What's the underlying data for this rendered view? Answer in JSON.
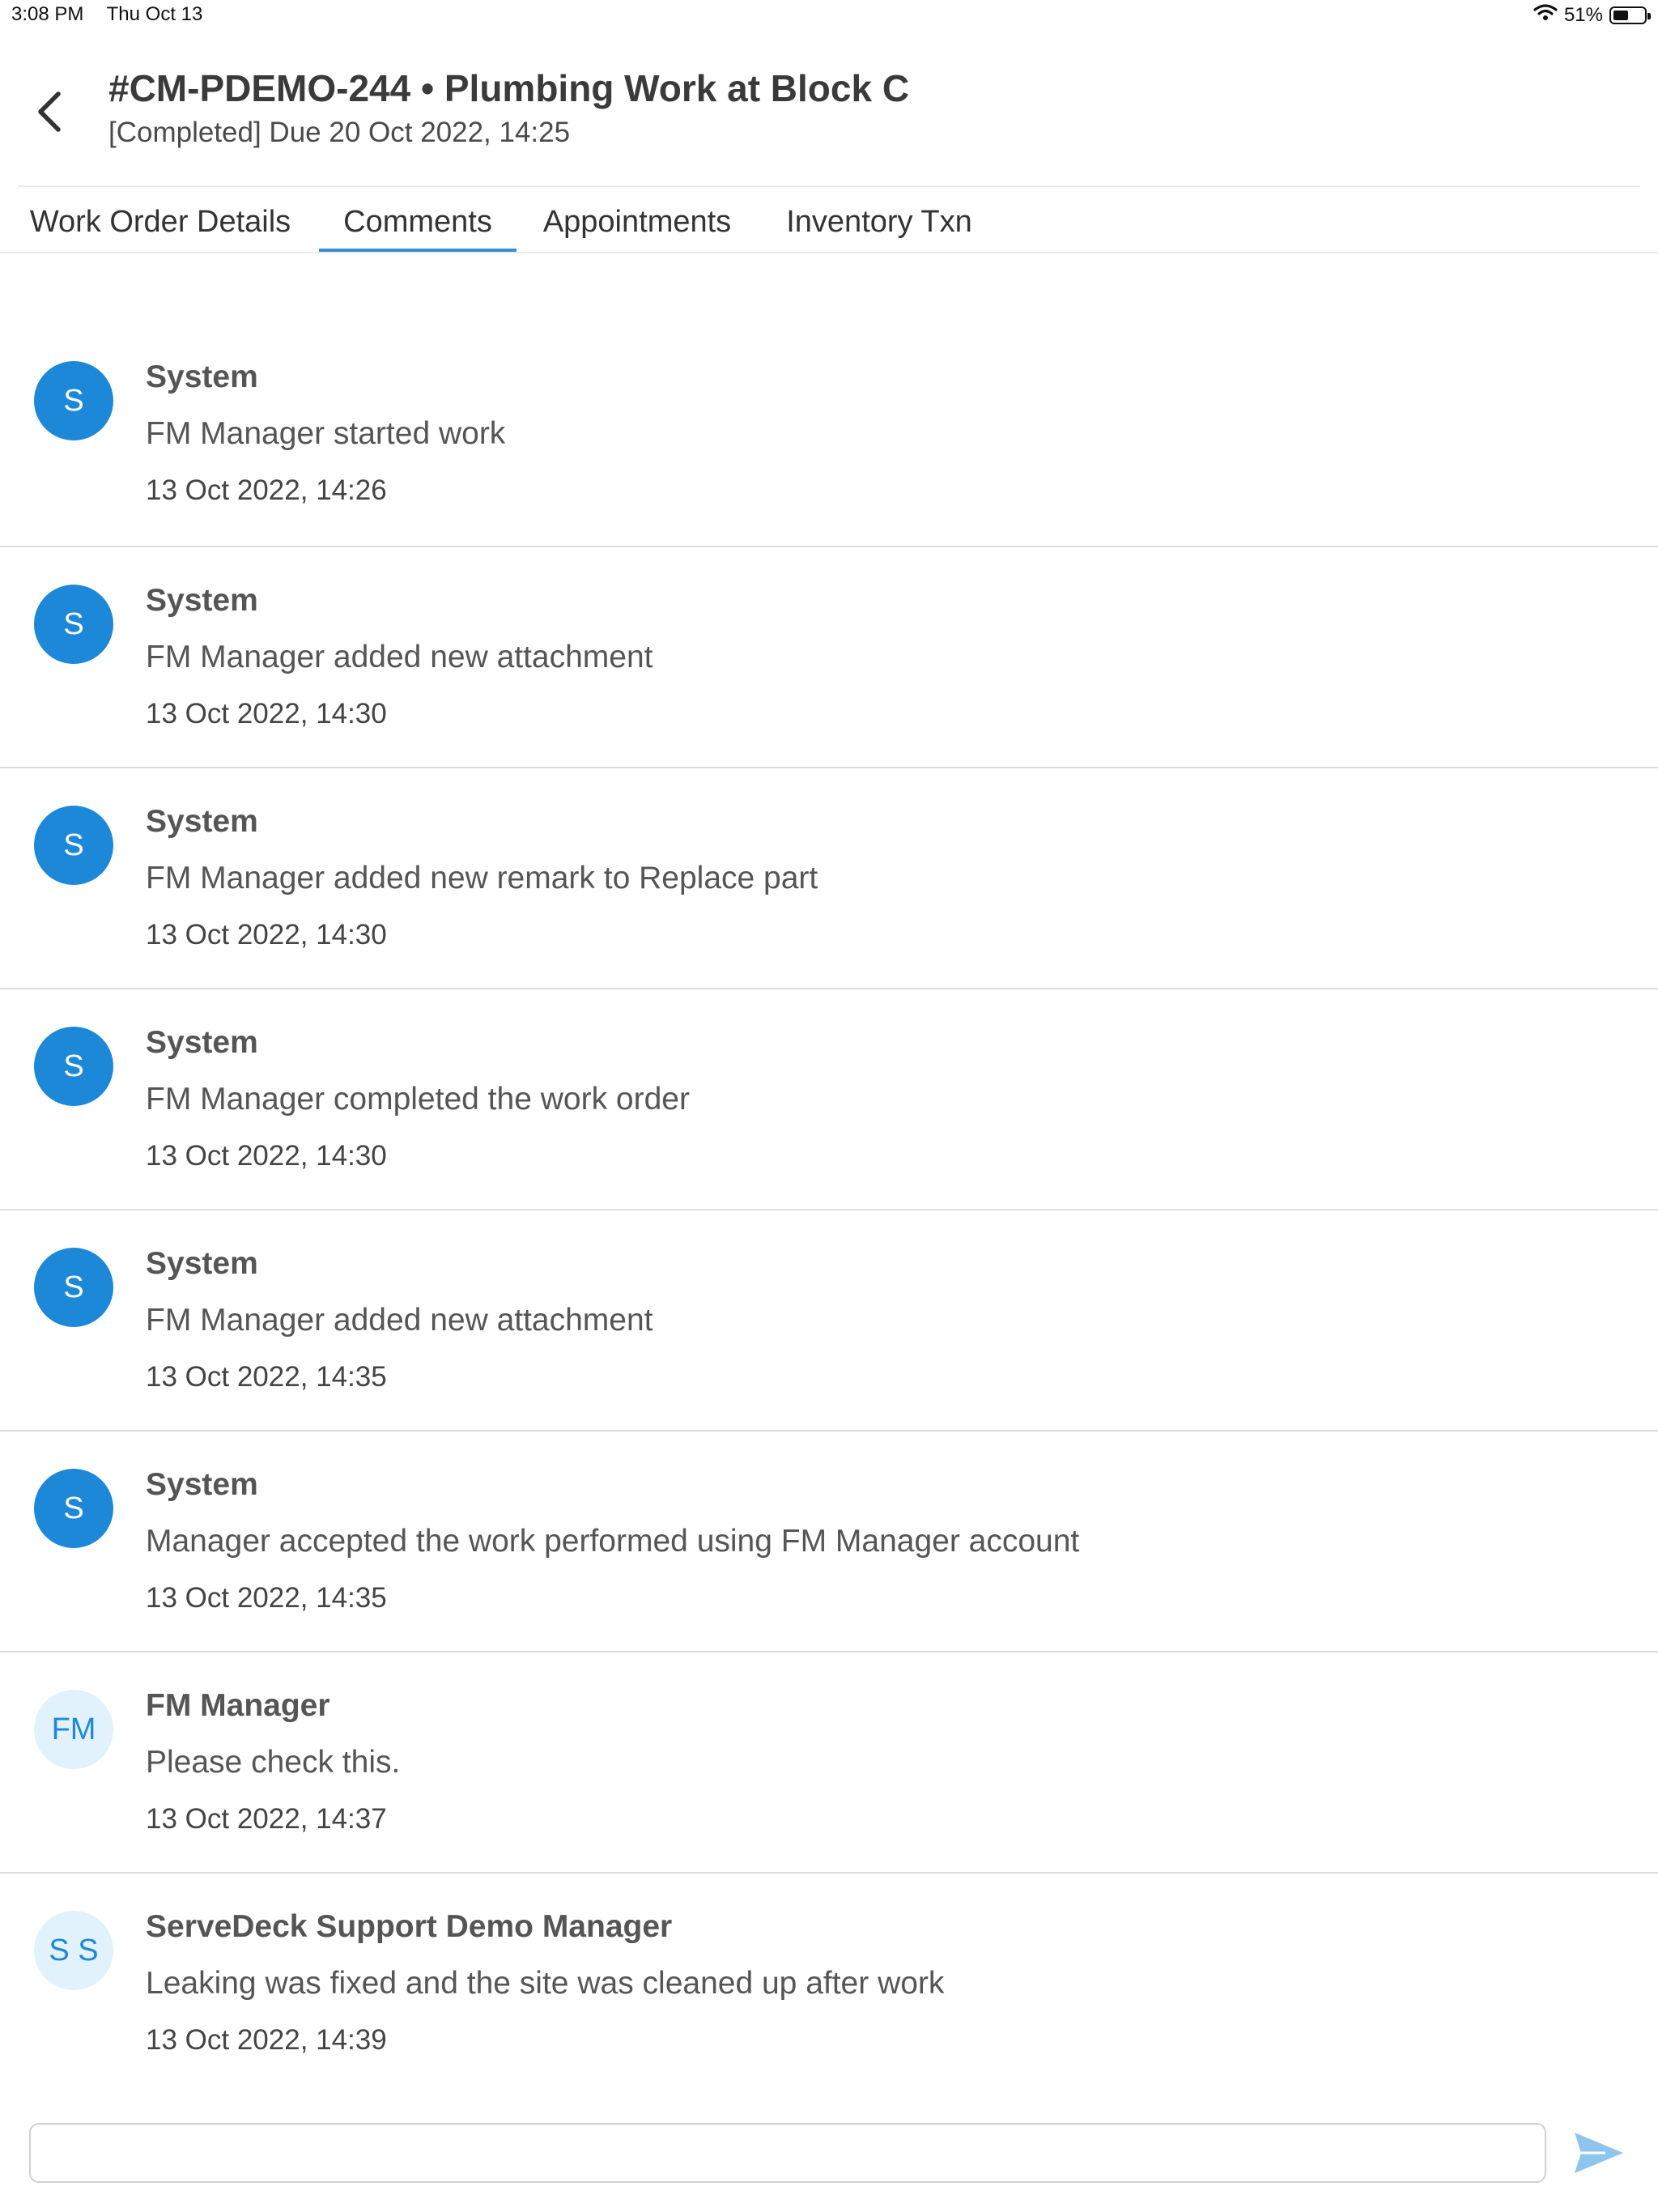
{
  "status_bar": {
    "time": "3:08 PM",
    "date": "Thu Oct 13",
    "battery": "51%",
    "battery_level": 0.51
  },
  "header": {
    "title": "#CM-PDEMO-244 • Plumbing Work at Block C",
    "subtitle": "[Completed] Due 20 Oct 2022, 14:25"
  },
  "tabs": [
    {
      "label": "Work Order Details",
      "active": false
    },
    {
      "label": "Comments",
      "active": true
    },
    {
      "label": "Appointments",
      "active": false
    },
    {
      "label": "Inventory Txn",
      "active": false
    }
  ],
  "comments": [
    {
      "initials": "S",
      "author": "System",
      "message": "FM Manager started work",
      "time": "13 Oct 2022, 14:26"
    },
    {
      "initials": "S",
      "author": "System",
      "message": "FM Manager added new attachment",
      "time": "13 Oct 2022, 14:30"
    },
    {
      "initials": "S",
      "author": "System",
      "message": "FM Manager added new remark to Replace part",
      "time": "13 Oct 2022, 14:30"
    },
    {
      "initials": "S",
      "author": "System",
      "message": "FM Manager completed the work order",
      "time": "13 Oct 2022, 14:30"
    },
    {
      "initials": "S",
      "author": "System",
      "message": "FM Manager added new attachment",
      "time": "13 Oct 2022, 14:35"
    },
    {
      "initials": "S",
      "author": "System",
      "message": "Manager accepted the work performed using FM Manager account",
      "time": "13 Oct 2022, 14:35"
    },
    {
      "initials": "FM",
      "author": "FM Manager",
      "message": "Please check this.",
      "time": "13 Oct 2022, 14:37"
    },
    {
      "initials": "S S",
      "author": "ServeDeck Support Demo Manager",
      "message": "Leaking was fixed and the site was cleaned up after work",
      "time": "13 Oct 2022, 14:39"
    }
  ],
  "composer": {
    "value": "",
    "placeholder": ""
  },
  "colors": {
    "accent": "#1e88d8",
    "avatar_light": "#e1f2fc",
    "send_icon": "#8ec5ec"
  },
  "icons": {
    "back": "chevron-left-icon",
    "send": "send-icon",
    "wifi": "wifi-icon",
    "battery": "battery-icon"
  }
}
